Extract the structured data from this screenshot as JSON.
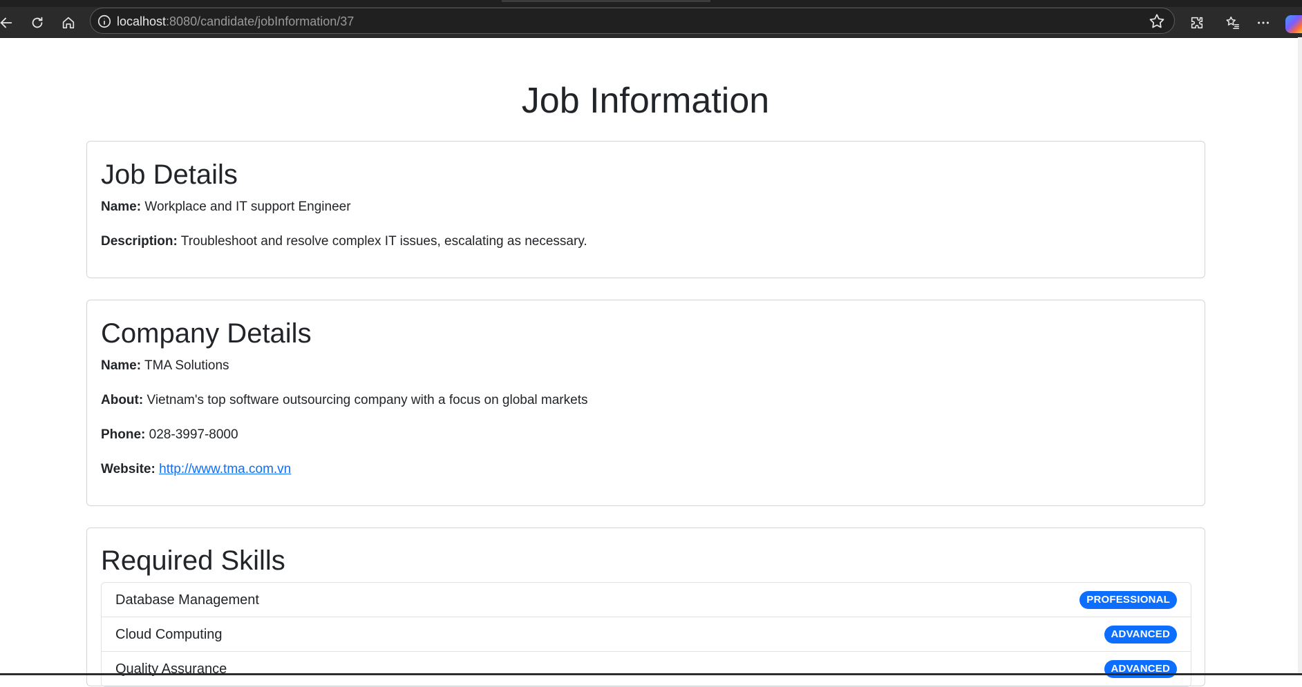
{
  "browser": {
    "url_host": "localhost",
    "url_path": ":8080/candidate/jobInformation/37",
    "icons": {
      "back": "back-arrow-icon",
      "refresh": "refresh-icon",
      "home": "home-icon",
      "info": "info-icon",
      "favorite": "star-icon",
      "extensions": "puzzle-icon",
      "favorites_list": "favorites-list-icon",
      "more": "more-dots-icon"
    }
  },
  "page": {
    "title": "Job Information"
  },
  "job": {
    "heading": "Job Details",
    "name_label": "Name:",
    "name_value": "Workplace and IT support Engineer",
    "description_label": "Description:",
    "description_value": "Troubleshoot and resolve complex IT issues, escalating as necessary."
  },
  "company": {
    "heading": "Company Details",
    "name_label": "Name:",
    "name_value": "TMA Solutions",
    "about_label": "About:",
    "about_value": "Vietnam's top software outsourcing company with a focus on global markets",
    "phone_label": "Phone:",
    "phone_value": "028-3997-8000",
    "website_label": "Website:",
    "website_value": "http://www.tma.com.vn"
  },
  "skills": {
    "heading": "Required Skills",
    "items": [
      {
        "name": "Database Management",
        "level": "PROFESSIONAL"
      },
      {
        "name": "Cloud Computing",
        "level": "ADVANCED"
      },
      {
        "name": "Quality Assurance",
        "level": "ADVANCED"
      }
    ]
  },
  "colors": {
    "badge": "#0d6efd",
    "link": "#0d6efd",
    "chrome": "#2b2b2b"
  }
}
